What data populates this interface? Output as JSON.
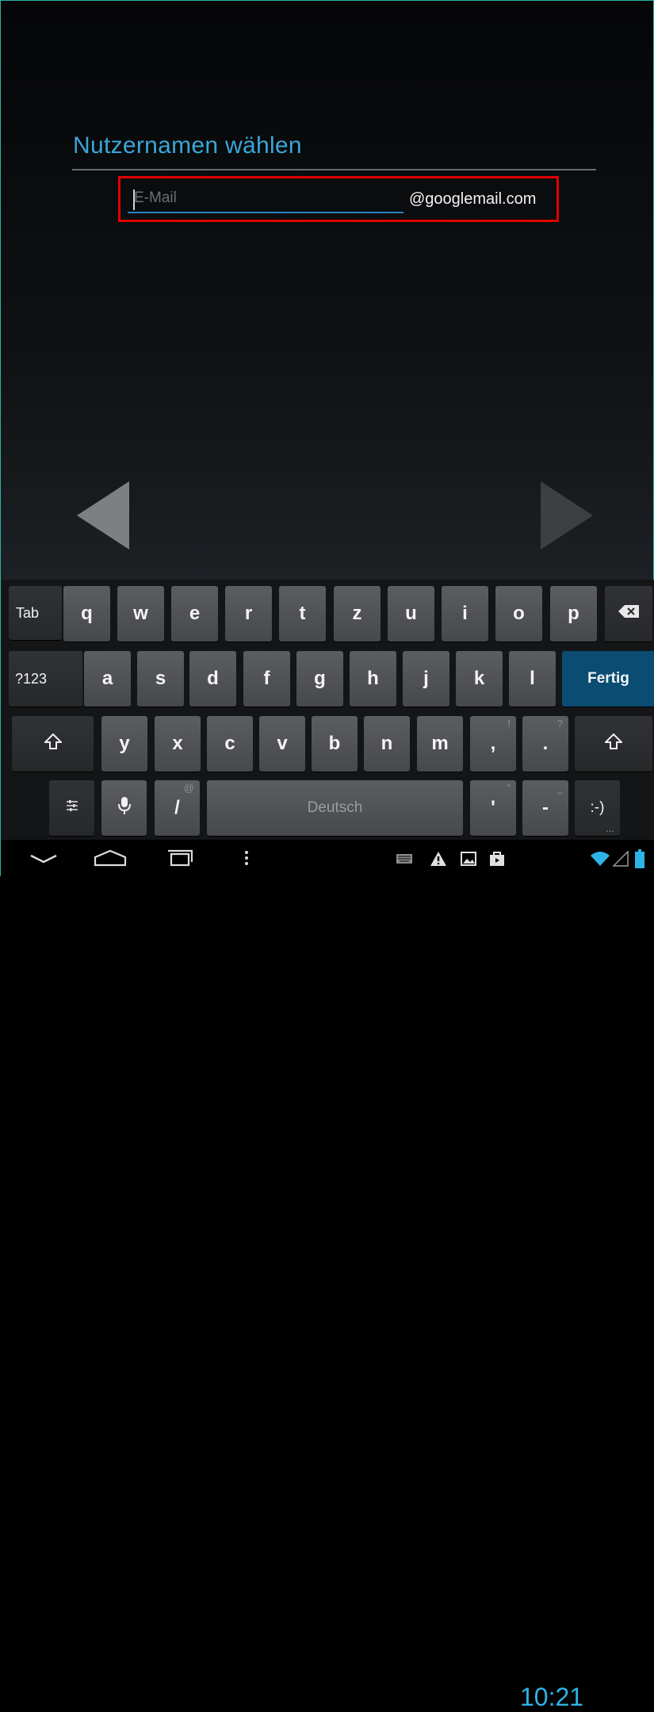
{
  "setup": {
    "title": "Nutzernamen wählen",
    "email_placeholder": "E-Mail",
    "domain_suffix": "@googlemail.com",
    "accent_color": "#3aa6d8",
    "highlight_color": "#e00000"
  },
  "keyboard": {
    "row1": [
      "Tab",
      "q",
      "w",
      "e",
      "r",
      "t",
      "z",
      "u",
      "i",
      "o",
      "p"
    ],
    "row2": [
      "?123",
      "a",
      "s",
      "d",
      "f",
      "g",
      "h",
      "j",
      "k",
      "l",
      "Fertig"
    ],
    "row3": [
      "y",
      "x",
      "c",
      "v",
      "b",
      "n",
      "m",
      ",",
      "."
    ],
    "row3_sub": [
      "!",
      "?"
    ],
    "row4": {
      "settings_icon": "keyboard-settings-icon",
      "mic_icon": "microphone-icon",
      "slash": "/",
      "slash_sub": "@",
      "space_label": "Deutsch",
      "apostrophe": "'",
      "apostrophe_sub": "\"",
      "dash": "-",
      "dash_sub": "_",
      "smiley": ":-)",
      "smiley_sub": "..."
    },
    "icons": {
      "backspace": "backspace-icon",
      "shift": "shift-icon"
    }
  },
  "navbar": {
    "back_icon": "back-chevron-icon",
    "home_icon": "home-icon",
    "recents_icon": "recent-apps-icon",
    "menu_icon": "menu-dots-icon",
    "status_icons": [
      "keyboard-icon",
      "warning-icon",
      "gallery-icon",
      "store-icon",
      "wifi-icon",
      "signal-icon",
      "battery-icon"
    ],
    "time": "10:21",
    "time_color": "#2eb3e6"
  }
}
